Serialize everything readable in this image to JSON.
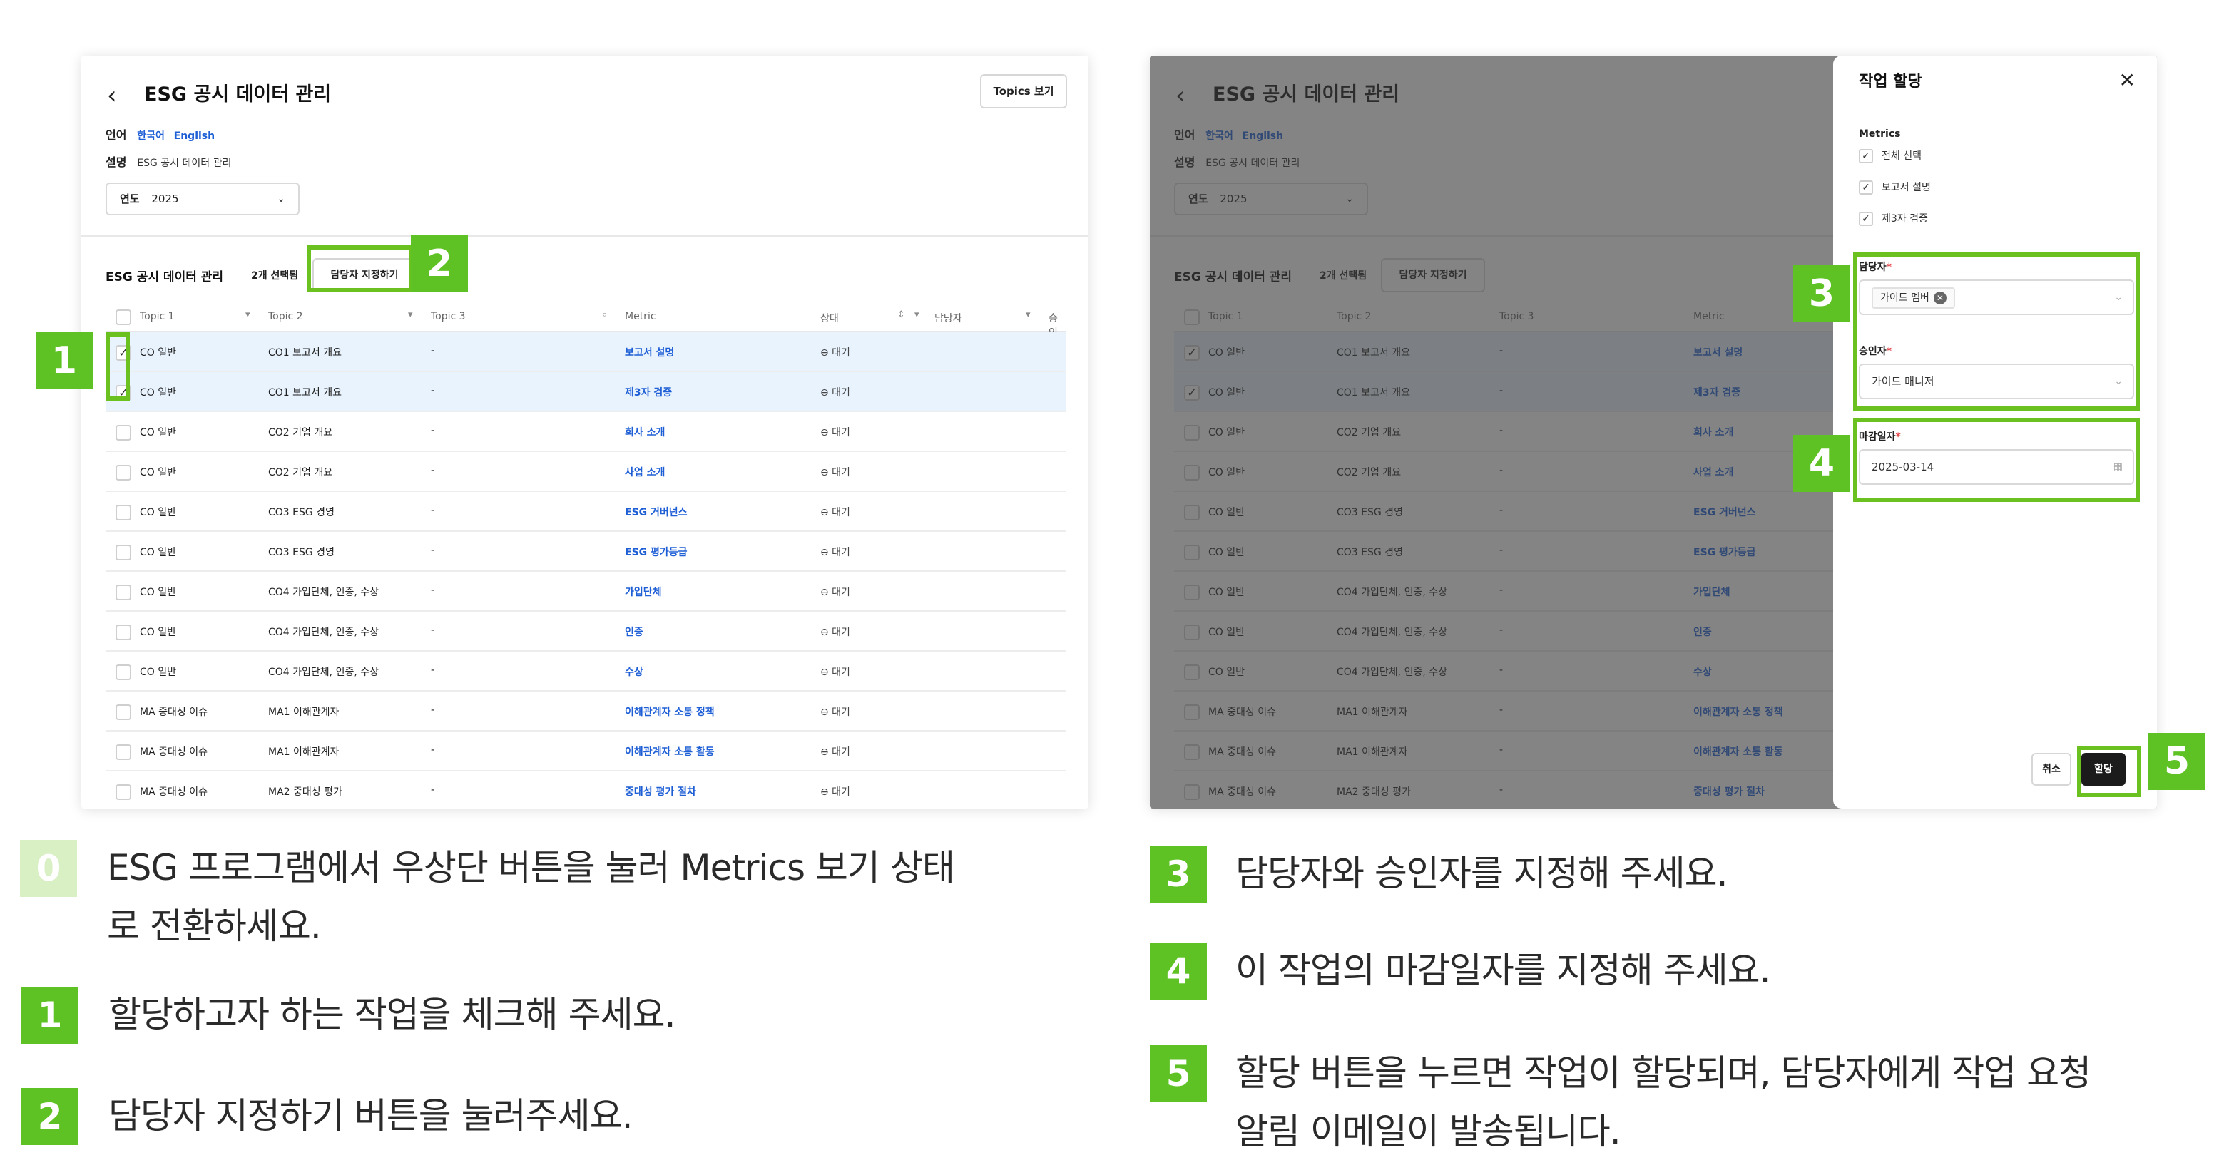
{
  "app": {
    "title": "ESG 공시 데이터 관리",
    "topics_button": "Topics 보기",
    "language_key": "언어",
    "language_ko": "한국어",
    "language_en": "English",
    "desc_key": "설명",
    "desc_value": "ESG 공시 데이터 관리",
    "year_key": "연도",
    "year_value": "2025",
    "section_title": "ESG 공시 데이터 관리",
    "selected_count": "2개 선택됨",
    "assign_button": "담당자 지정하기"
  },
  "table": {
    "headers": [
      "Topic 1",
      "Topic 2",
      "Topic 3",
      "Metric",
      "상태",
      "담당자",
      "승인"
    ],
    "rows": [
      {
        "checked": true,
        "t1": "CO 일반",
        "t2": "CO1 보고서 개요",
        "t3": "-",
        "metric": "보고서 설명",
        "status": "⊖ 대기"
      },
      {
        "checked": true,
        "t1": "CO 일반",
        "t2": "CO1 보고서 개요",
        "t3": "-",
        "metric": "제3자 검증",
        "status": "⊖ 대기"
      },
      {
        "checked": false,
        "t1": "CO 일반",
        "t2": "CO2 기업 개요",
        "t3": "-",
        "metric": "회사 소개",
        "status": "⊖ 대기"
      },
      {
        "checked": false,
        "t1": "CO 일반",
        "t2": "CO2 기업 개요",
        "t3": "-",
        "metric": "사업 소개",
        "status": "⊖ 대기"
      },
      {
        "checked": false,
        "t1": "CO 일반",
        "t2": "CO3 ESG 경영",
        "t3": "-",
        "metric": "ESG 거버넌스",
        "status": "⊖ 대기"
      },
      {
        "checked": false,
        "t1": "CO 일반",
        "t2": "CO3 ESG 경영",
        "t3": "-",
        "metric": "ESG 평가등급",
        "status": "⊖ 대기"
      },
      {
        "checked": false,
        "t1": "CO 일반",
        "t2": "CO4 가입단체, 인증, 수상",
        "t3": "-",
        "metric": "가입단체",
        "status": "⊖ 대기"
      },
      {
        "checked": false,
        "t1": "CO 일반",
        "t2": "CO4 가입단체, 인증, 수상",
        "t3": "-",
        "metric": "인증",
        "status": "⊖ 대기"
      },
      {
        "checked": false,
        "t1": "CO 일반",
        "t2": "CO4 가입단체, 인증, 수상",
        "t3": "-",
        "metric": "수상",
        "status": "⊖ 대기"
      },
      {
        "checked": false,
        "t1": "MA 중대성 이슈",
        "t2": "MA1 이해관계자",
        "t3": "-",
        "metric": "이해관계자 소통 정책",
        "status": "⊖ 대기"
      },
      {
        "checked": false,
        "t1": "MA 중대성 이슈",
        "t2": "MA1 이해관계자",
        "t3": "-",
        "metric": "이해관계자 소통 활동",
        "status": "⊖ 대기"
      },
      {
        "checked": false,
        "t1": "MA 중대성 이슈",
        "t2": "MA2 중대성 평가",
        "t3": "-",
        "metric": "중대성 평가 절차",
        "status": "⊖ 대기"
      }
    ]
  },
  "drawer": {
    "title": "작업 할당",
    "metrics_label": "Metrics",
    "checks": [
      "전체 선택",
      "보고서 설명",
      "제3자 검증"
    ],
    "assignee_label": "담당자",
    "assignee_tag": "가이드 멤버",
    "approver_label": "승인자",
    "approver_value": "가이드 매니저",
    "due_label": "마감일자",
    "due_value": "2025-03-14",
    "cancel": "취소",
    "confirm": "할당"
  },
  "badges": {
    "b1": "1",
    "b2": "2",
    "b3": "3",
    "b4": "4",
    "b5": "5"
  },
  "steps": [
    {
      "num": "0",
      "text_line1": "ESG 프로그램에서 우상단 버튼을 눌러 Metrics 보기 상태",
      "text_line2": "로 전환하세요."
    },
    {
      "num": "1",
      "text": "할당하고자 하는 작업을 체크해 주세요."
    },
    {
      "num": "2",
      "text": "담당자 지정하기 버튼을 눌러주세요."
    },
    {
      "num": "3",
      "text": "담당자와 승인자를 지정해 주세요."
    },
    {
      "num": "4",
      "text": "이 작업의 마감일자를 지정해 주세요."
    },
    {
      "num": "5",
      "text_line1": "할당 버튼을 누르면 작업이 할당되며, 담당자에게 작업 요청",
      "text_line2": "알림 이메일이 발송됩니다."
    }
  ],
  "colors": {
    "accent_green": "#5ec224",
    "link_blue": "#1f5fd6",
    "selected_row": "#e8f3fe"
  }
}
